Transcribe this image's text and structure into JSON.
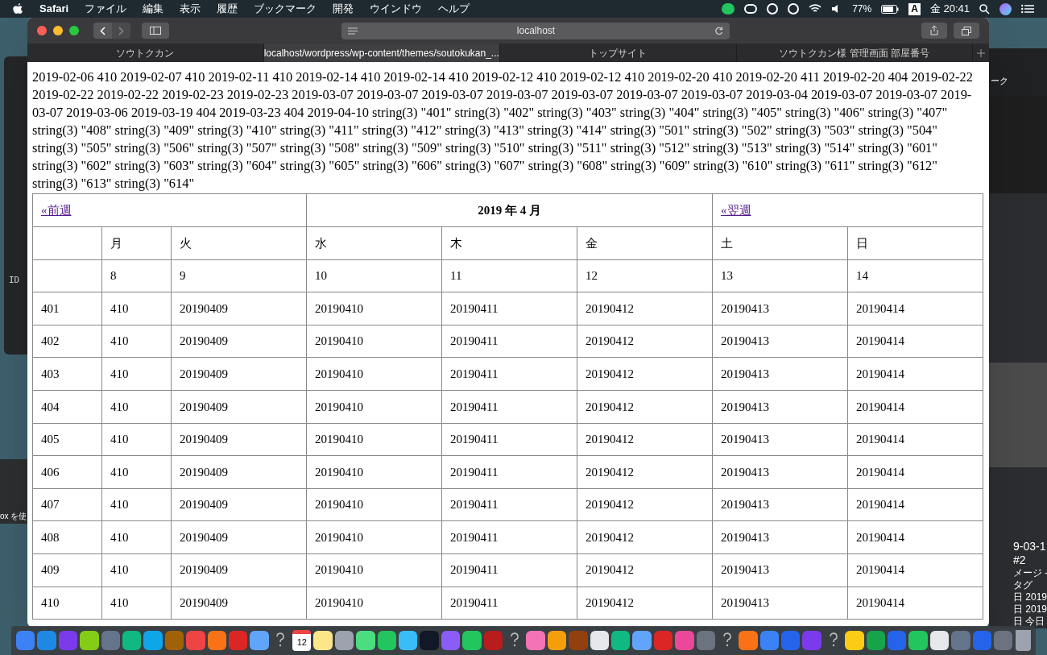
{
  "menubar": {
    "app": "Safari",
    "menus": [
      "ファイル",
      "編集",
      "表示",
      "履歴",
      "ブックマーク",
      "開発",
      "ウインドウ",
      "ヘルプ"
    ],
    "battery": "77%",
    "input_mode": "A",
    "clock": "金 20:41"
  },
  "browser": {
    "address": "localhost",
    "tabs": [
      {
        "label": "ソウトクカン",
        "selected": false
      },
      {
        "label": "localhost/wordpress/wp-content/themes/soutokukan_...",
        "selected": true
      },
      {
        "label": "トップサイト",
        "selected": false
      },
      {
        "label": "ソウトクカン様 管理画面 部屋番号",
        "selected": false
      }
    ]
  },
  "page": {
    "debug_output": "2019-02-06 410 2019-02-07 410 2019-02-11 410 2019-02-14 410 2019-02-14 410 2019-02-12 410 2019-02-12 410 2019-02-20 410 2019-02-20 411 2019-02-20 404 2019-02-22 2019-02-22 2019-02-22 2019-02-23 2019-02-23 2019-03-07 2019-03-07 2019-03-07 2019-03-07 2019-03-07 2019-03-07 2019-03-07 2019-03-04 2019-03-07 2019-03-07 2019-03-07 2019-03-06 2019-03-19 404 2019-03-23 404 2019-04-10 string(3) \"401\" string(3) \"402\" string(3) \"403\" string(3) \"404\" string(3) \"405\" string(3) \"406\" string(3) \"407\" string(3) \"408\" string(3) \"409\" string(3) \"410\" string(3) \"411\" string(3) \"412\" string(3) \"413\" string(3) \"414\" string(3) \"501\" string(3) \"502\" string(3) \"503\" string(3) \"504\" string(3) \"505\" string(3) \"506\" string(3) \"507\" string(3) \"508\" string(3) \"509\" string(3) \"510\" string(3) \"511\" string(3) \"512\" string(3) \"513\" string(3) \"514\" string(3) \"601\" string(3) \"602\" string(3) \"603\" string(3) \"604\" string(3) \"605\" string(3) \"606\" string(3) \"607\" string(3) \"608\" string(3) \"609\" string(3) \"610\" string(3) \"611\" string(3) \"612\" string(3) \"613\" string(3) \"614\"",
    "calendar": {
      "prev_link": "«前週",
      "title": "2019 年 4 月",
      "next_link": "«翌週",
      "weekdays": [
        "月",
        "火",
        "水",
        "木",
        "金",
        "土",
        "日"
      ],
      "dates": [
        "8",
        "9",
        "10",
        "11",
        "12",
        "13",
        "14"
      ],
      "rows": [
        [
          "401",
          "410",
          "20190409",
          "20190410",
          "20190411",
          "20190412",
          "20190413",
          "20190414"
        ],
        [
          "402",
          "410",
          "20190409",
          "20190410",
          "20190411",
          "20190412",
          "20190413",
          "20190414"
        ],
        [
          "403",
          "410",
          "20190409",
          "20190410",
          "20190411",
          "20190412",
          "20190413",
          "20190414"
        ],
        [
          "404",
          "410",
          "20190409",
          "20190410",
          "20190411",
          "20190412",
          "20190413",
          "20190414"
        ],
        [
          "405",
          "410",
          "20190409",
          "20190410",
          "20190411",
          "20190412",
          "20190413",
          "20190414"
        ],
        [
          "406",
          "410",
          "20190409",
          "20190410",
          "20190411",
          "20190412",
          "20190413",
          "20190414"
        ],
        [
          "407",
          "410",
          "20190409",
          "20190410",
          "20190411",
          "20190412",
          "20190413",
          "20190414"
        ],
        [
          "408",
          "410",
          "20190409",
          "20190410",
          "20190411",
          "20190412",
          "20190413",
          "20190414"
        ],
        [
          "409",
          "410",
          "20190409",
          "20190410",
          "20190411",
          "20190412",
          "20190413",
          "20190414"
        ],
        [
          "410",
          "410",
          "20190409",
          "20190410",
          "20190411",
          "20190412",
          "20190413",
          "20190414"
        ]
      ]
    }
  },
  "background_windows": {
    "left": [
      "ID",
      "ox を使"
    ],
    "right": [
      "ーク",
      "9-03-1",
      "#2",
      "メージ -",
      "タグ",
      "日 2019",
      "日 2019",
      "日 今日"
    ]
  },
  "dock": {
    "calendar_day": "12"
  }
}
